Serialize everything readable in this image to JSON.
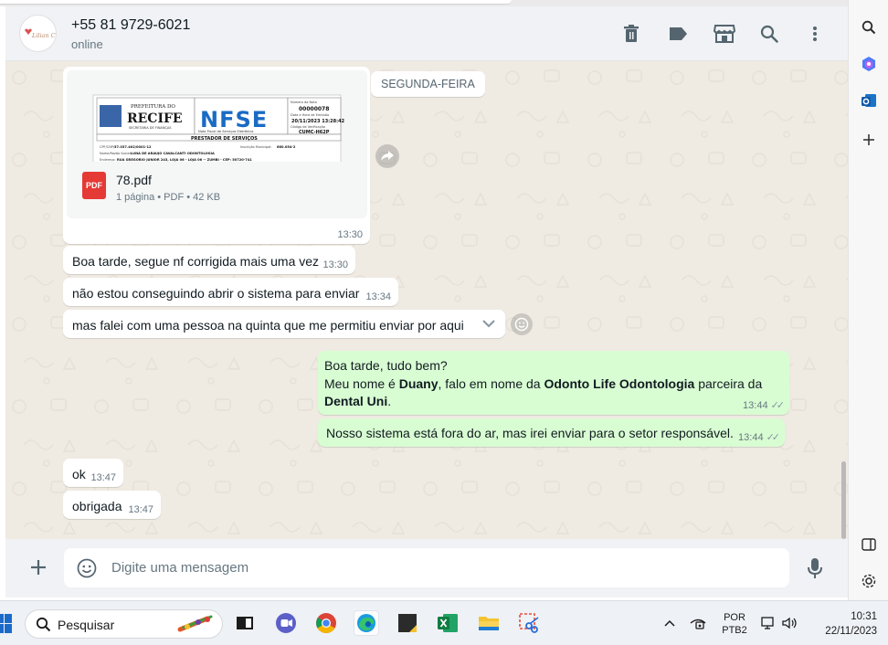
{
  "header": {
    "contact_name": "+55 81 9729-6021",
    "status": "online",
    "avatar_text": "Lilian Cunha"
  },
  "chat": {
    "day_separator": "SEGUNDA-FEIRA",
    "document": {
      "preview": {
        "line1": "PREFEITURA DO",
        "city": "RECIFE",
        "line3": "SECRETARIA DE FINANÇAS",
        "logo": "NFSE",
        "subtitle": "Nota Fiscal de Serviços Eletrônica",
        "number_label": "Número da Nota",
        "number": "00000078",
        "date_label": "Data e Hora de Emissão",
        "date": "20/11/2023 13:28:42",
        "code_label": "Código de Verificação",
        "code": "CUMC-H62P",
        "section": "PRESTADOR DE SERVIÇOS",
        "cpf_label": "CPF/CNPJ:",
        "cpf": "37.037.402/0001-12",
        "im_label": "Inscrição Municipal:",
        "im": "660.054-2",
        "name_label": "Nome/Razão Social:",
        "name": "LUNA DE ARAUJO CAVALCANTI ODONTOLOGIA",
        "addr_label": "Endereço:",
        "addr": "RUA GREGORIO JUNIOR 243, LOJA 06 - LOJA 06 -- ZUMBI - CEP: 50720-741"
      },
      "filename": "78.pdf",
      "meta": "1 página • PDF • 42 KB",
      "icon_label": "PDF",
      "time": "13:30"
    },
    "messages": [
      {
        "direction": "in",
        "text": "Boa tarde, segue nf corrigida mais uma vez",
        "time": "13:30"
      },
      {
        "direction": "in",
        "text": "não estou conseguindo abrir o sistema para enviar",
        "time": "13:34"
      },
      {
        "direction": "in",
        "text": "mas falei com uma pessoa na quinta que me permitiu enviar por aqui",
        "time": "13:34"
      },
      {
        "direction": "out",
        "line1": "Boa tarde, tudo bem?",
        "line2_a": "Meu nome é ",
        "line2_b": "Duany",
        "line2_c": ", falo em nome da ",
        "line2_d": "Odonto Life Odontologia",
        "line2_e": " parceira da",
        "line3_a": "Dental Uni",
        "line3_b": ".",
        "time": "13:44"
      },
      {
        "direction": "out",
        "text": "Nosso sistema está fora do ar, mas irei enviar para o setor responsável.",
        "time": "13:44"
      },
      {
        "direction": "in",
        "text": "ok",
        "time": "13:47"
      },
      {
        "direction": "in",
        "text": "obrigada",
        "time": "13:47"
      }
    ]
  },
  "composer": {
    "placeholder": "Digite uma mensagem"
  },
  "taskbar": {
    "search_placeholder": "Pesquisar",
    "lang_line1": "POR",
    "lang_line2": "PTB2",
    "time": "10:31",
    "date": "22/11/2023"
  },
  "colors": {
    "chat_bg": "#efeae2",
    "incoming_bubble": "#ffffff",
    "outgoing_bubble": "#d9fdd3",
    "header_bg": "#f0f2f5",
    "pdf_red": "#e53935",
    "nfse_blue": "#1a6bc4"
  },
  "icons": {
    "header": [
      "trash-icon",
      "label-icon",
      "store-icon",
      "search-icon",
      "menu-icon"
    ],
    "rail": [
      "search-icon",
      "copilot-icon",
      "outlook-icon",
      "add-icon",
      "sidebar-icon",
      "settings-icon"
    ],
    "taskbar_apps": [
      "widgets-icon",
      "teams-icon",
      "chrome-icon",
      "edge-icon",
      "sticky-notes-icon",
      "excel-icon",
      "file-explorer-icon",
      "snipping-tool-icon"
    ]
  }
}
